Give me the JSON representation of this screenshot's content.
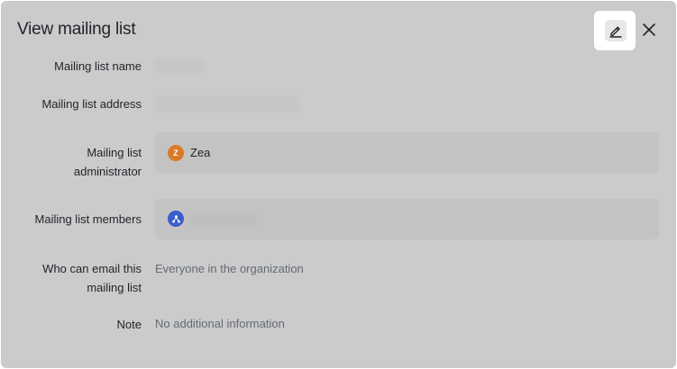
{
  "dialog": {
    "title": "View mailing list",
    "edit_icon": "pencil-edit-icon",
    "close_icon": "close-icon"
  },
  "fields": {
    "name_label": "Mailing list name",
    "address_label": "Mailing list address",
    "admin_label_line1": "Mailing list",
    "admin_label_line2": "administrator",
    "admin": {
      "initial": "Z",
      "name": "Zea",
      "avatar_color": "#d97a27"
    },
    "members_label": "Mailing list members",
    "members": {
      "avatar_icon": "group-icon",
      "avatar_color": "#3a5ccc"
    },
    "who_can_email_label_line1": "Who can email this",
    "who_can_email_label_line2": "mailing list",
    "who_can_email_value": "Everyone in the organization",
    "note_label": "Note",
    "note_value": "No additional information"
  }
}
